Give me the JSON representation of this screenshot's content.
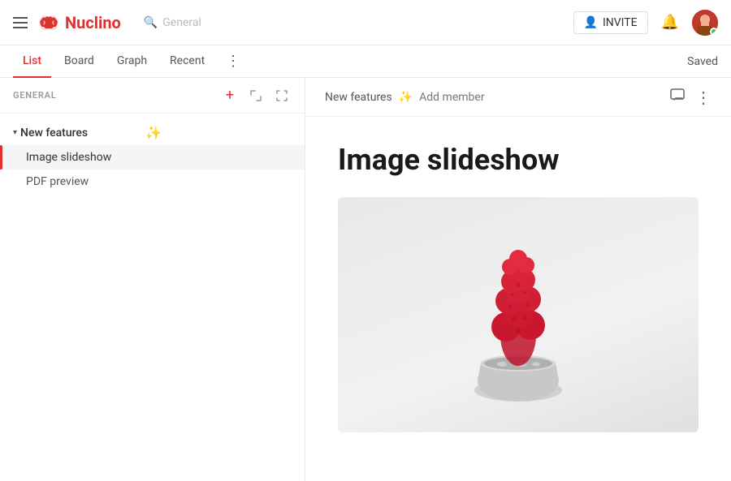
{
  "navbar": {
    "logo_text": "Nuclino",
    "search_placeholder": "General",
    "invite_label": "INVITE",
    "saved_label": "Saved"
  },
  "tabs": [
    {
      "id": "list",
      "label": "List",
      "active": true
    },
    {
      "id": "board",
      "label": "Board",
      "active": false
    },
    {
      "id": "graph",
      "label": "Graph",
      "active": false
    },
    {
      "id": "recent",
      "label": "Recent",
      "active": false
    }
  ],
  "sidebar": {
    "title": "GENERAL",
    "add_icon": "+",
    "expand_icon": "⤢",
    "collapse_icon": "≪",
    "groups": [
      {
        "id": "new-features",
        "title": "New features",
        "emoji": "✨",
        "expanded": true,
        "items": [
          {
            "id": "image-slideshow",
            "label": "Image slideshow",
            "active": true
          },
          {
            "id": "pdf-preview",
            "label": "PDF preview",
            "active": false
          }
        ]
      }
    ]
  },
  "content": {
    "breadcrumb": "New features",
    "breadcrumb_emoji": "✨",
    "add_member_label": "Add member",
    "doc_title": "Image slideshow"
  }
}
